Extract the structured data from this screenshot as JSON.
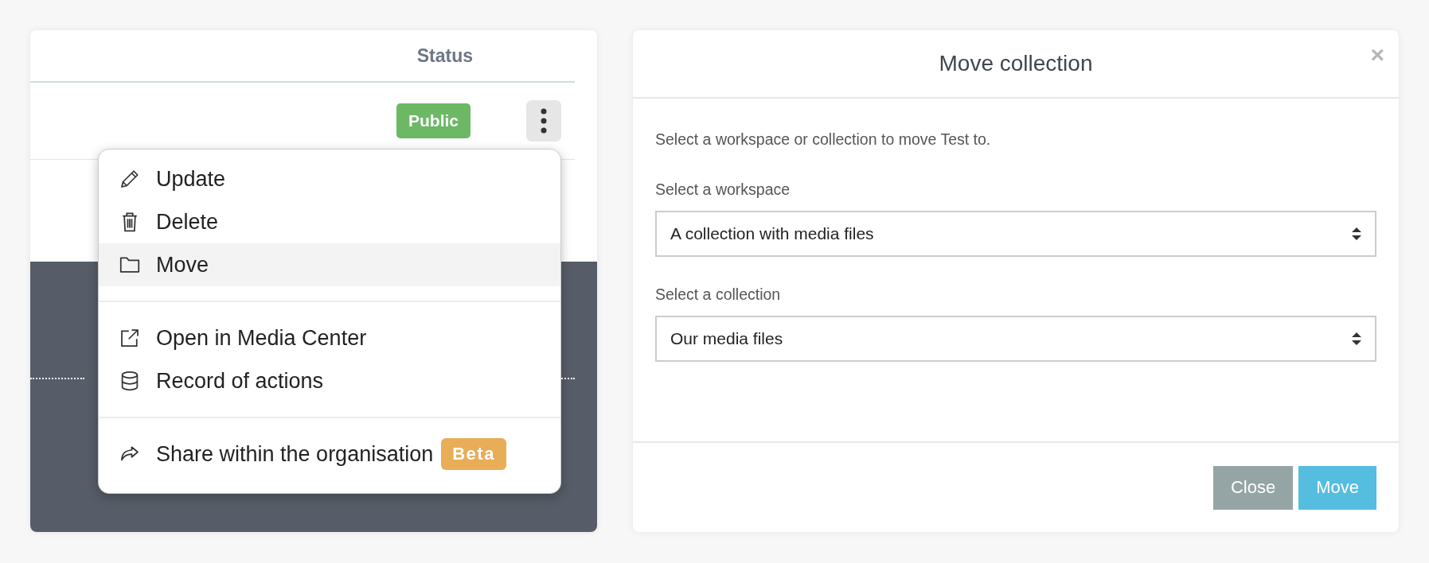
{
  "table": {
    "columns": [
      "Status"
    ],
    "rows": [
      {
        "status": "Public"
      }
    ]
  },
  "menu": {
    "groups": [
      {
        "items": [
          {
            "label": "Update",
            "selected": false
          },
          {
            "label": "Delete",
            "selected": false
          },
          {
            "label": "Move",
            "selected": true
          }
        ]
      },
      {
        "items": [
          {
            "label": "Open in Media Center",
            "selected": false
          },
          {
            "label": "Record of actions",
            "selected": false
          }
        ]
      },
      {
        "items": [
          {
            "label": "Share within the organisation",
            "selected": false,
            "badge": "Beta"
          }
        ]
      }
    ]
  },
  "modal": {
    "title": "Move collection",
    "close": "×",
    "intro": "Select a workspace or collection to move Test to.",
    "fields": [
      {
        "label": "Select a workspace",
        "value": "A collection with media files"
      },
      {
        "label": "Select a collection",
        "value": "Our media files"
      }
    ],
    "buttons": [
      {
        "label": "Close",
        "kind": "secondary"
      },
      {
        "label": "Move",
        "kind": "primary"
      }
    ]
  }
}
